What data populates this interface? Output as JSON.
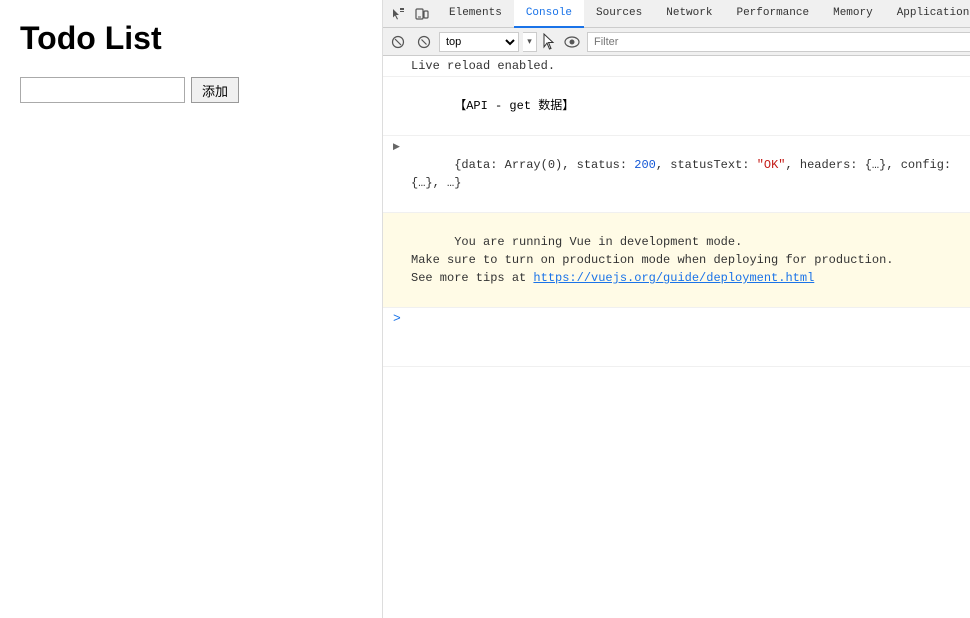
{
  "app": {
    "title": "Todo List",
    "input_placeholder": "",
    "add_button_label": "添加"
  },
  "devtools": {
    "tabs": [
      {
        "id": "elements",
        "label": "Elements",
        "active": false
      },
      {
        "id": "console",
        "label": "Console",
        "active": true
      },
      {
        "id": "sources",
        "label": "Sources",
        "active": false
      },
      {
        "id": "network",
        "label": "Network",
        "active": false
      },
      {
        "id": "performance",
        "label": "Performance",
        "active": false
      },
      {
        "id": "memory",
        "label": "Memory",
        "active": false
      },
      {
        "id": "application",
        "label": "Application",
        "active": false
      }
    ],
    "toolbar": {
      "context_selector": "top",
      "filter_placeholder": "Filter"
    },
    "console_output": [
      {
        "type": "info",
        "text": "Live reload enabled."
      },
      {
        "type": "api-label",
        "text": "【API - get 数据】"
      },
      {
        "type": "expandable",
        "text": "{data: Array(0), status: 200, statusText: \"OK\", headers: {…}, config: {…}, …}"
      },
      {
        "type": "warning",
        "lines": [
          "You are running Vue in development mode.",
          "Make sure to turn on production mode when deploying for production.",
          "See more tips at "
        ],
        "link_text": "https://vuejs.org/guide/deployment.html",
        "link_href": "https://vuejs.org/guide/deployment.html"
      },
      {
        "type": "prompt",
        "text": ""
      }
    ]
  }
}
